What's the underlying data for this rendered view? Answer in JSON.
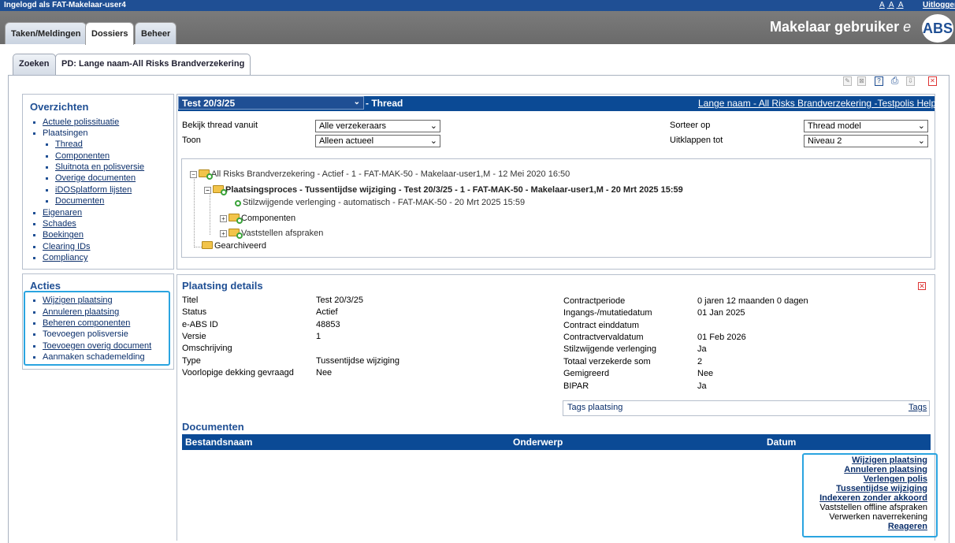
{
  "topbar": {
    "login_text": "Ingelogd als FAT-Makelaar-user4",
    "font_sizes": [
      "A",
      "A",
      "A"
    ],
    "logout": "Uitloggen"
  },
  "main_tabs": [
    {
      "label": "Taken/Meldingen",
      "active": false
    },
    {
      "label": "Dossiers",
      "active": true
    },
    {
      "label": "Beheer",
      "active": false
    }
  ],
  "brand": {
    "title": "Makelaar gebruiker",
    "logo_text": "ABS",
    "logo_prefix": "e"
  },
  "sub_tabs": [
    {
      "label": "Zoeken",
      "active": false
    },
    {
      "label": "PD: Lange naam-All Risks Brandverzekering",
      "active": true
    }
  ],
  "overzichten": {
    "title": "Overzichten",
    "items": [
      "Actuele polissituatie",
      "Plaatsingen",
      "Thread",
      "Componenten",
      "Sluitnota en polisversie",
      "Overige documenten",
      "iDOSplatform lijsten",
      "Documenten",
      "Eigenaren",
      "Schades",
      "Boekingen",
      "Clearing IDs",
      "Compliancy"
    ]
  },
  "acties": {
    "title": "Acties",
    "items": [
      "Wijzigen plaatsing",
      "Annuleren plaatsing",
      "Beheren componenten",
      "Toevoegen polisversie",
      "Toevoegen overig document",
      "Aanmaken schademelding"
    ]
  },
  "thread": {
    "selected": "Test 20/3/25",
    "label": "- Thread",
    "help_link": "Lange naam - All Risks Brandverzekering -Testpolis Help",
    "bekijk_label": "Bekijk thread vanuit",
    "bekijk_value": "Alle verzekeraars",
    "toon_label": "Toon",
    "toon_value": "Alleen actueel",
    "sorteer_label": "Sorteer op",
    "sorteer_value": "Thread model",
    "uitklappen_label": "Uitklappen tot",
    "uitklappen_value": "Niveau 2"
  },
  "tree": {
    "root": "All Risks Brandverzekering - Actief - 1 - FAT-MAK-50 - Makelaar-user1,M - 12 Mei 2020 16:50",
    "proc": "Plaatsingsproces - Tussentijdse wijziging - Test 20/3/25 - 1 - FAT-MAK-50 - Makelaar-user1,M - 20 Mrt 2025 15:59",
    "stil": "Stilzwijgende verlenging - automatisch - FAT-MAK-50 - 20 Mrt 2025 15:59",
    "comp": "Componenten",
    "vast": "Vaststellen afspraken",
    "arch": "Gearchiveerd"
  },
  "details": {
    "title": "Plaatsing details",
    "left": [
      {
        "k": "Titel",
        "v": "Test 20/3/25"
      },
      {
        "k": "Status",
        "v": "Actief"
      },
      {
        "k": "e-ABS ID",
        "v": "48853"
      },
      {
        "k": "Versie",
        "v": "1"
      },
      {
        "k": "Omschrijving",
        "v": ""
      },
      {
        "k": "Type",
        "v": "Tussentijdse wijziging"
      },
      {
        "k": "Voorlopige dekking gevraagd",
        "v": "Nee"
      }
    ],
    "right": [
      {
        "k": "Contractperiode",
        "v": "0 jaren 12 maanden 0 dagen"
      },
      {
        "k": "Ingangs-/mutatiedatum",
        "v": "01 Jan 2025"
      },
      {
        "k": "Contract einddatum",
        "v": ""
      },
      {
        "k": "Contractvervaldatum",
        "v": "01 Feb 2026"
      },
      {
        "k": "Stilzwijgende verlenging",
        "v": "Ja"
      },
      {
        "k": "Totaal verzekerde som",
        "v": "2"
      },
      {
        "k": "Gemigreerd",
        "v": "Nee"
      },
      {
        "k": "BIPAR",
        "v": "Ja"
      }
    ],
    "tags_label": "Tags plaatsing",
    "tags_link": "Tags"
  },
  "documents": {
    "title": "Documenten",
    "col_name": "Bestandsnaam",
    "col_subject": "Onderwerp",
    "col_date": "Datum"
  },
  "right_actions": [
    {
      "label": "Wijzigen plaatsing",
      "link": true
    },
    {
      "label": "Annuleren plaatsing",
      "link": true
    },
    {
      "label": "Verlengen polis",
      "link": true
    },
    {
      "label": "Tussentijdse wijziging",
      "link": true
    },
    {
      "label": "Indexeren zonder akkoord",
      "link": true
    },
    {
      "label": "Vaststellen offline afspraken",
      "link": false
    },
    {
      "label": "Verwerken naverrekening",
      "link": false
    },
    {
      "label": "Reageren",
      "link": true
    }
  ],
  "colors": {
    "brand_blue": "#1f4f94",
    "dark_blue": "#0b4a95",
    "highlight": "#2aa4e0"
  }
}
